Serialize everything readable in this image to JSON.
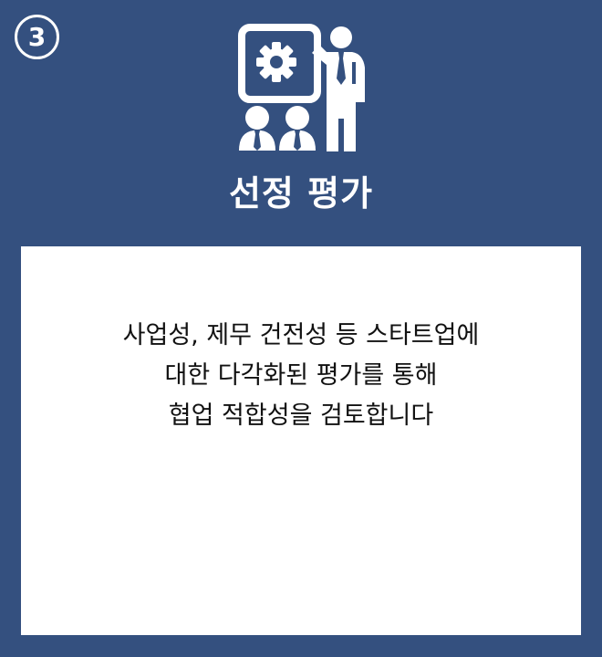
{
  "badge": {
    "number": "3"
  },
  "hero": {
    "icon": "presentation-evaluation-icon"
  },
  "title": "선정 평가",
  "description": {
    "lines": [
      "사업성, 제무 건전성 등 스타트업에",
      "대한 다각화된 평가를 통해",
      "협업 적합성을 검토합니다"
    ]
  },
  "colors": {
    "background": "#34507f",
    "card": "#ffffff",
    "text": "#111111",
    "accent": "#ffffff"
  }
}
